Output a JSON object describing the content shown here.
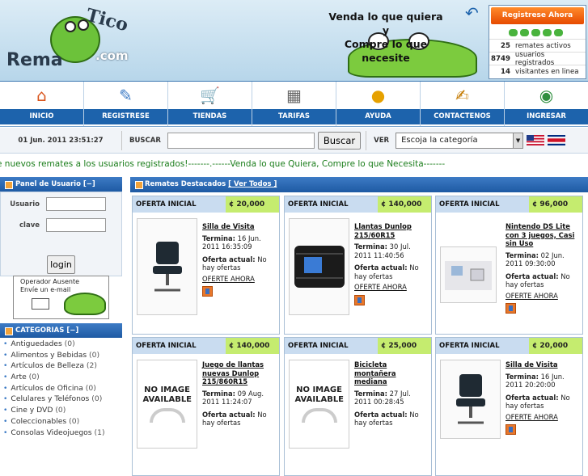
{
  "header": {
    "logo_top": "Tico",
    "logo_main": "Rema",
    "logo_com": ".com",
    "slogan_1": "Venda lo que quiera y",
    "slogan_2": "Compre lo que necesite",
    "register_button": "Registrese Ahora",
    "stats": [
      {
        "value": "25",
        "label": "remates activos"
      },
      {
        "value": "8749",
        "label": "usuarios registrados"
      },
      {
        "value": "14",
        "label": "visitantes en linea"
      }
    ]
  },
  "nav": [
    {
      "label": "INICIO",
      "icon": "home-icon"
    },
    {
      "label": "REGISTRESE",
      "icon": "register-icon"
    },
    {
      "label": "TIENDAS",
      "icon": "cart-icon"
    },
    {
      "label": "TARIFAS",
      "icon": "calculator-icon"
    },
    {
      "label": "AYUDA",
      "icon": "lightbulb-icon"
    },
    {
      "label": "CONTACTENOS",
      "icon": "edit-icon"
    },
    {
      "label": "INGRESAR",
      "icon": "login-icon"
    }
  ],
  "toolbar": {
    "datetime": "01 Jun. 2011 23:51:27",
    "search_label": "BUSCAR",
    "search_button": "Buscar",
    "ver_label": "VER",
    "category_selected": "Escoja la categoría"
  },
  "marquee": "e nuevos remates a los usuarios registrados!-------.------Venda lo que Quiera, Compre lo que Necesita-------",
  "sidebar": {
    "panel_title": "Panel de Usuario",
    "panel_toggle": "[−]",
    "user_label": "Usuario",
    "pass_label": "clave",
    "login_button": "login",
    "operator_line1": "Operador Ausente",
    "operator_line2": "Envíe un e-mail",
    "categories_title": "CATEGORIAS",
    "categories_toggle": "[−]",
    "categories": [
      {
        "name": "Antiguedades",
        "count": "(0)"
      },
      {
        "name": "Alimentos y Bebidas",
        "count": "(0)"
      },
      {
        "name": "Artículos de Belleza",
        "count": "(2)"
      },
      {
        "name": "Arte",
        "count": "(0)"
      },
      {
        "name": "Artículos de Oficina",
        "count": "(0)"
      },
      {
        "name": "Celulares y Teléfonos",
        "count": "(0)"
      },
      {
        "name": "Cine y DVD",
        "count": "(0)"
      },
      {
        "name": "Coleccionables",
        "count": "(0)"
      },
      {
        "name": "Consolas Videojuegos",
        "count": "(1)"
      }
    ]
  },
  "main": {
    "header_title": "Remates Destacados",
    "header_link": "[ Ver Todos ]",
    "cards": [
      {
        "label": "OFERTA INICIAL",
        "price": "¢ 20,000",
        "title": "Silla de Visita",
        "termina_label": "Termina:",
        "termina": "16 Jun. 2011 16:35:09",
        "oferta_label": "Oferta actual:",
        "oferta": "No hay ofertas",
        "link": "OFERTE AHORA",
        "image": "chair"
      },
      {
        "label": "OFERTA INICIAL",
        "price": "¢ 140,000",
        "title": "Llantas Dunlop 215/60R15",
        "termina_label": "Termina:",
        "termina": "30 Jul. 2011 11:40:56",
        "oferta_label": "Oferta actual:",
        "oferta": "No hay ofertas",
        "link": "OFERTE AHORA",
        "image": "tires"
      },
      {
        "label": "OFERTA INICIAL",
        "price": "¢ 96,000",
        "title": "Nintendo DS Lite con 3 juegos, Casi sin Uso",
        "termina_label": "Termina:",
        "termina": "02 Jun. 2011 09:30:00",
        "oferta_label": "Oferta actual:",
        "oferta": "No hay ofertas",
        "link": "OFERTE AHORA",
        "image": "ds"
      },
      {
        "label": "OFERTA INICIAL",
        "price": "¢ 140,000",
        "title": "Juego de llantas nuevas Dunlop 215/860R15",
        "termina_label": "Termina:",
        "termina": "09 Aug. 2011 11:24:07",
        "oferta_label": "Oferta actual:",
        "oferta": "No hay ofertas",
        "link": "OFERTE AHORA",
        "image": "none",
        "no_image": "NO IMAGE AVAILABLE"
      },
      {
        "label": "OFERTA INICIAL",
        "price": "¢ 25,000",
        "title": "Bicicleta montañera mediana",
        "termina_label": "Termina:",
        "termina": "27 Jul. 2011 00:28:45",
        "oferta_label": "Oferta actual:",
        "oferta": "No hay ofertas",
        "link": "OFERTE AHORA",
        "image": "none",
        "no_image": "NO IMAGE AVAILABLE"
      },
      {
        "label": "OFERTA INICIAL",
        "price": "¢ 20,000",
        "title": "Silla de Visita",
        "termina_label": "Termina:",
        "termina": "16 Jun. 2011 20:20:00",
        "oferta_label": "Oferta actual:",
        "oferta": "No hay ofertas",
        "link": "OFERTE AHORA",
        "image": "chair"
      }
    ]
  }
}
